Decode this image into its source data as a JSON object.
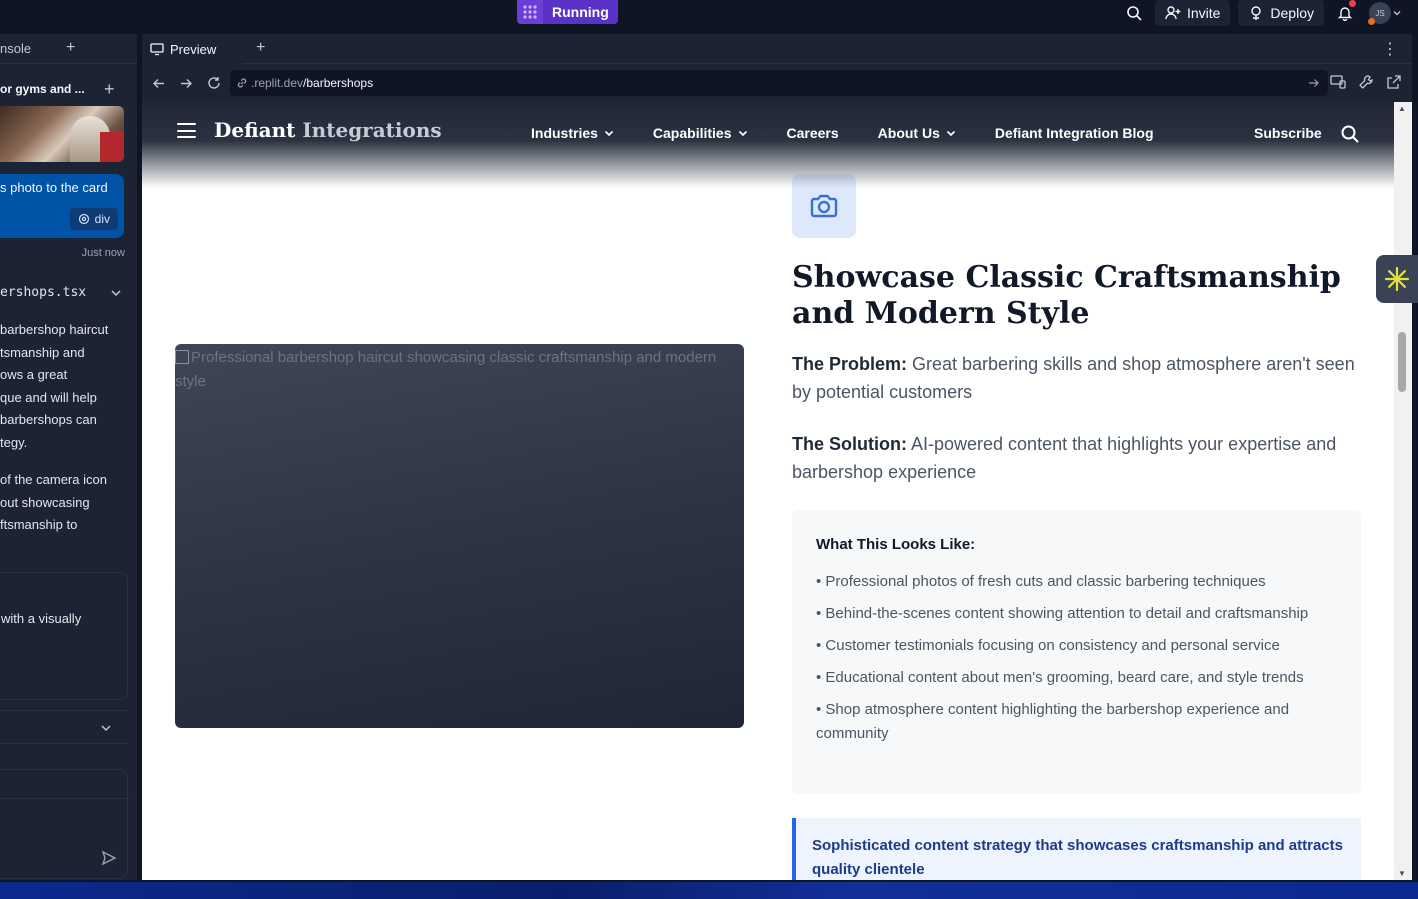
{
  "topbar": {
    "run_status": "Running",
    "invite_label": "Invite",
    "deploy_label": "Deploy",
    "avatar_initials": "JS"
  },
  "left_pane": {
    "tab_label": "nsole",
    "chat_title": "or gyms and ...",
    "bubble_text": "s photo to the card",
    "element_chip": "div",
    "timestamp": "Just now",
    "file_name": "ershops.tsx",
    "paragraph1": [
      "barbershop haircut",
      "tsmanship and",
      "ows a great",
      "que and will help",
      " barbershops can",
      "tegy."
    ],
    "paragraph2": [
      "of the camera icon",
      "out showcasing",
      "ftsmanship to"
    ],
    "card_text": " with a visually"
  },
  "right_pane": {
    "tab_label": "Preview",
    "url_prefix": ".replit.dev",
    "url_path": "/barbershops"
  },
  "site": {
    "brand_main": "Defiant",
    "brand_accent": "Integrations",
    "menu": {
      "industries": "Industries",
      "capabilities": "Capabilities",
      "careers": "Careers",
      "about": "About Us",
      "blog": "Defiant Integration Blog"
    },
    "subscribe": "Subscribe",
    "image_alt": "Professional barbershop haircut showcasing classic craftsmanship and modern style",
    "heading": "Showcase Classic Craftsmanship and Modern Style",
    "problem_label": "The Problem:",
    "problem_text": " Great barbering skills and shop atmosphere aren't seen by potential customers",
    "solution_label": "The Solution:",
    "solution_text": " AI-powered content that highlights your expertise and barbershop experience",
    "looks_title": "What This Looks Like:",
    "looks_items": [
      "• Professional photos of fresh cuts and classic barbering techniques",
      "• Behind-the-scenes content showing attention to detail and craftsmanship",
      "• Customer testimonials focusing on consistency and personal service",
      "• Educational content about men's grooming, beard care, and style trends",
      "• Shop atmosphere content highlighting the barbershop experience and community"
    ],
    "callout": "Sophisticated content strategy that showcases craftsmanship and attracts quality clientele"
  },
  "colors": {
    "replit_bg": "#0e1525",
    "panel": "#1c2333",
    "running": "#5b32c8",
    "accent_blue": "#2563eb",
    "camera_tile": "#dde9fb"
  }
}
